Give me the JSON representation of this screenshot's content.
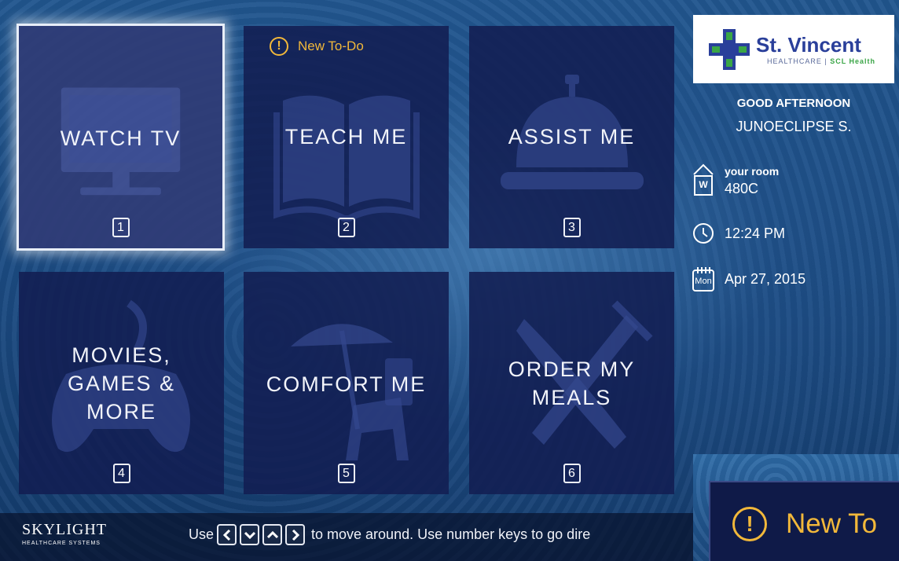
{
  "tiles": [
    {
      "label": "WATCH TV",
      "number": "1"
    },
    {
      "label": "TEACH ME",
      "number": "2"
    },
    {
      "label": "ASSIST ME",
      "number": "3"
    },
    {
      "label_lines": [
        "MOVIES,",
        "GAMES &",
        "MORE"
      ],
      "number": "4"
    },
    {
      "label": "COMFORT ME",
      "number": "5"
    },
    {
      "label_lines": [
        "ORDER MY",
        "MEALS"
      ],
      "number": "6"
    }
  ],
  "todo": {
    "icon": "!",
    "text": "New To-Do"
  },
  "logo": {
    "brand": "St. Vincent",
    "sub_left": "HEALTHCARE",
    "sub_right": "SCL Health"
  },
  "greeting": {
    "line1": "GOOD AFTERNOON",
    "line2": "JUNOECLIPSE S."
  },
  "room": {
    "heading": "your room",
    "icon_letter": "W",
    "value": "480C"
  },
  "time": "12:24 PM",
  "date": {
    "icon_day": "Mon",
    "value": "Apr 27, 2015"
  },
  "footer": {
    "brand": "SKYLIGHT",
    "brand_sub": "HEALTHCARE SYSTEMS",
    "hint_prefix": "Use",
    "hint_suffix": "to move around. Use number keys to go dire"
  },
  "zoom": {
    "icon": "!",
    "text": "New To"
  },
  "colors": {
    "accent": "#f2b83a",
    "tile": "#121e52",
    "logo_brand": "#2a3f9a"
  }
}
